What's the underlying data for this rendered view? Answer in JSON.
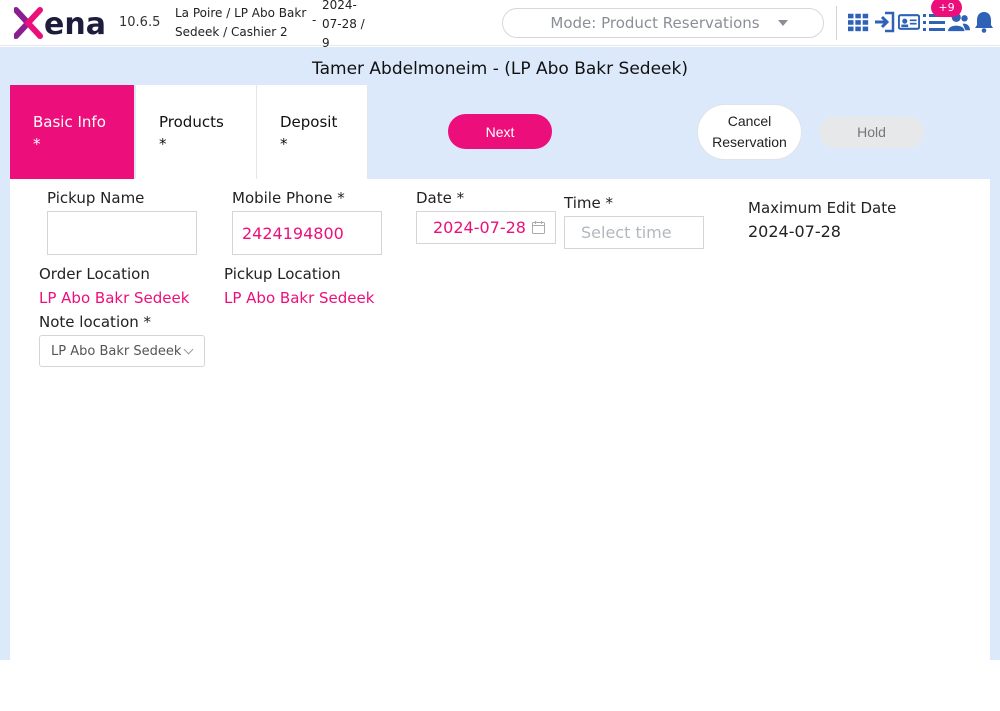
{
  "header": {
    "version": "10.6.5",
    "branch": "La Poire / LP Abo Bakr Sedeek / Cashier 2",
    "date_dash": "-",
    "date_info": "2024-07-28 / 9",
    "mode": "Mode: Product Reservations",
    "notification_count": "+9",
    "brand_color": "#ec0f7b",
    "icons": [
      "grid-icon",
      "login-arrow-icon",
      "id-card-icon",
      "list-icon",
      "users-icon",
      "bell-icon",
      "profile-icon"
    ]
  },
  "customer_title": "Tamer Abdelmoneim - (LP Abo Bakr Sedeek)",
  "tabs": [
    {
      "label": "Basic Info",
      "required": "*"
    },
    {
      "label": "Products",
      "required": "*"
    },
    {
      "label": "Deposit",
      "required": "*"
    }
  ],
  "actions": {
    "next": "Next",
    "cancel": "Cancel Reservation",
    "hold": "Hold"
  },
  "form": {
    "pickup_name": {
      "label": "Pickup Name",
      "value": ""
    },
    "mobile_phone": {
      "label": "Mobile Phone *",
      "value": "2424194800"
    },
    "date": {
      "label": "Date *",
      "value": "2024-07-28"
    },
    "time": {
      "label": "Time *",
      "placeholder": "Select time"
    },
    "max_edit_date": {
      "label": "Maximum Edit Date",
      "value": "2024-07-28"
    },
    "order_location": {
      "label": "Order Location",
      "value": "LP Abo Bakr Sedeek"
    },
    "pickup_location": {
      "label": "Pickup Location",
      "value": "LP Abo Bakr Sedeek"
    },
    "note_location": {
      "label": "Note location *",
      "value": "LP Abo Bakr Sedeek"
    }
  }
}
